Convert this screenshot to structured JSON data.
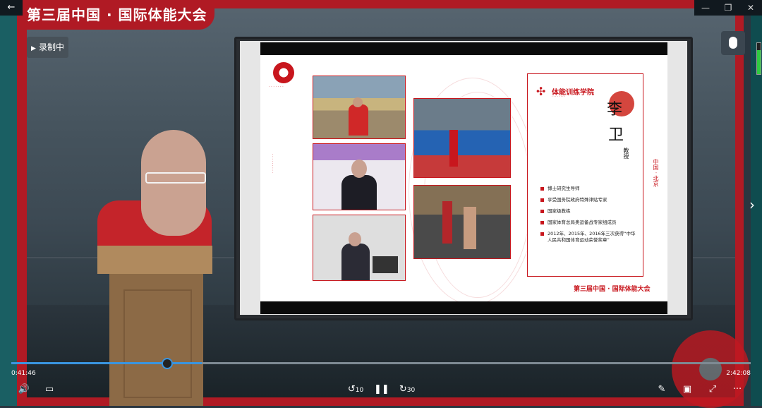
{
  "window": {
    "back_glyph": "←",
    "controls": [
      "—",
      "❐",
      "✕"
    ]
  },
  "banner": {
    "title": "第三届中国 · 国际体能大会"
  },
  "recording": {
    "label": "录制中",
    "icon": "play-triangle-icon"
  },
  "slide": {
    "card": {
      "school_name": "体能训练学院",
      "name_line1": "李",
      "name_line2": "卫",
      "role": "教授",
      "location": "中国 · 北京",
      "bullets": [
        "博士研究生导师",
        "享受国务院政府特殊津贴专家",
        "国家级教练",
        "国家体育总局奥运备战专家组成员",
        "2012年、2015年、2016年三次获得“中华人民共和国体育运动荣誉奖章”"
      ]
    },
    "footer": "第三届中国 · 国际体能大会"
  },
  "player": {
    "current_time": "0:41:46",
    "total_time": "2:42:08",
    "progress": 0.2575,
    "controls": {
      "volume": "🔊",
      "captions": "▭",
      "rewind": "10",
      "pause": "❚❚",
      "forward": "30",
      "pen": "✎",
      "miniview": "▣",
      "fullscreen": "⤢",
      "more": "···"
    }
  },
  "colors": {
    "brand_red": "#b01a24",
    "accent_blue": "#3a95e0"
  }
}
